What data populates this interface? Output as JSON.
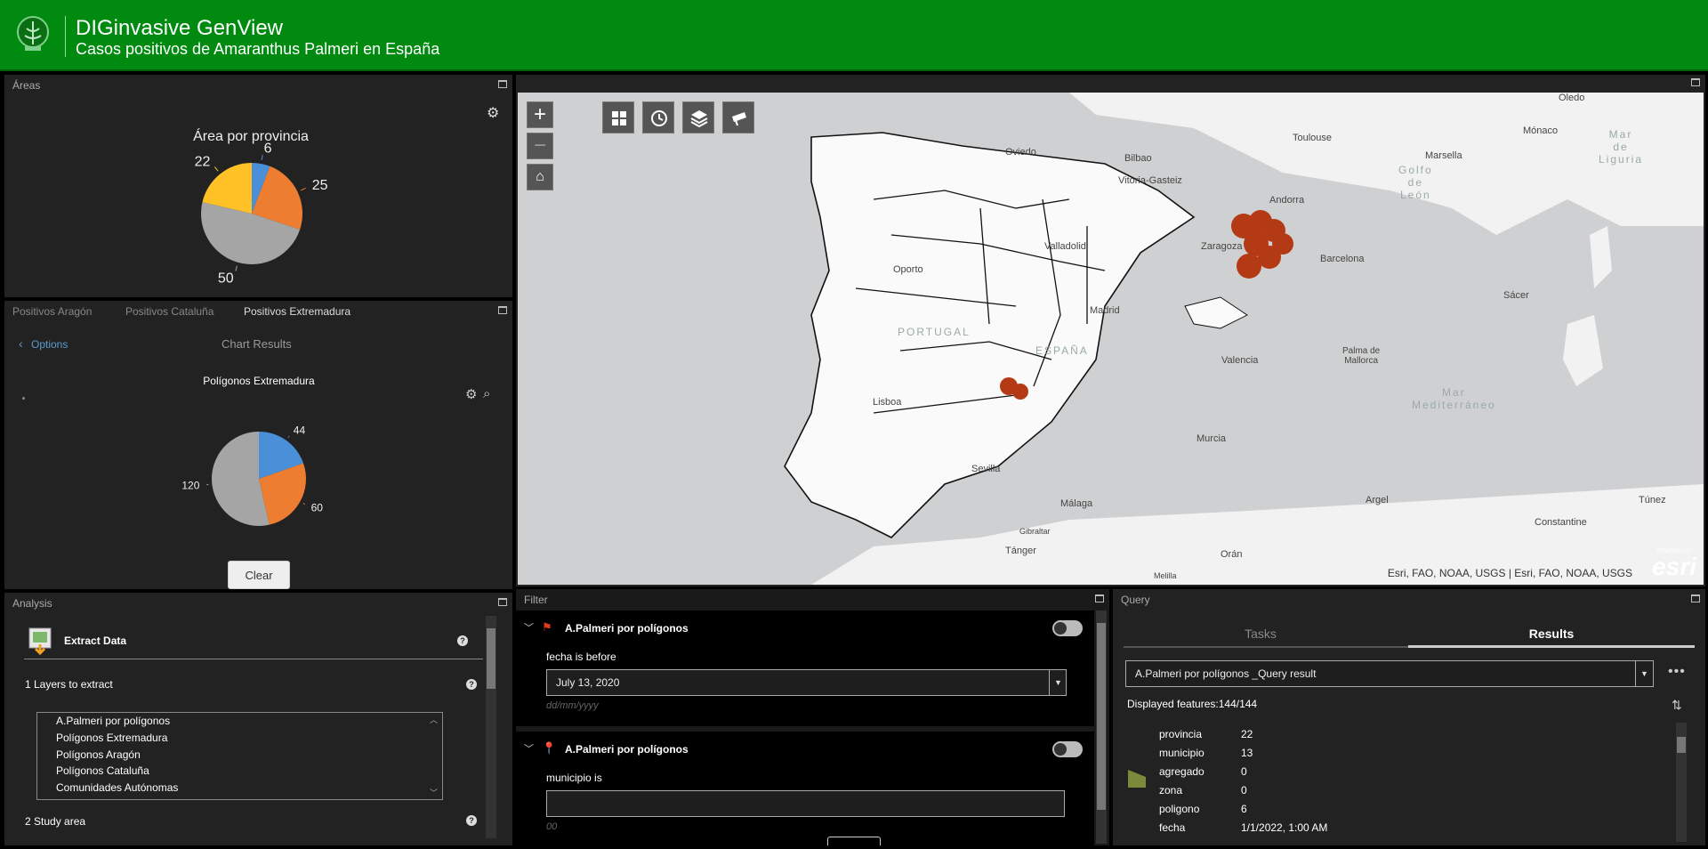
{
  "header": {
    "title": "DIGinvasive GenView",
    "subtitle": "Casos positivos de Amaranthus Palmeri en España"
  },
  "areas_panel": {
    "title": "Áreas",
    "chart_data": {
      "type": "pie",
      "title": "Área por provincia",
      "categories": [
        "6",
        "25",
        "50",
        "22"
      ],
      "values": [
        6,
        25,
        50,
        22
      ],
      "colors": [
        "#4a90d9",
        "#ed7d31",
        "#a5a5a5",
        "#ffc125"
      ]
    }
  },
  "positivos_panel": {
    "tabs": [
      "Positivos Aragón",
      "Positivos Cataluña",
      "Positivos Extremadura"
    ],
    "options_label": "Options",
    "chart_results_label": "Chart Results",
    "clear_label": "Clear",
    "chart_data": {
      "type": "pie",
      "title": "Polígonos Extremadura",
      "categories": [
        "44",
        "60",
        "120"
      ],
      "values": [
        44,
        60,
        120
      ],
      "colors": [
        "#4a90d9",
        "#ed7d31",
        "#a5a5a5"
      ]
    }
  },
  "analysis_panel": {
    "title": "Analysis",
    "extract_title": "Extract Data",
    "step1": "1 Layers to extract",
    "step2": "2 Study area",
    "layers": [
      "A.Palmeri por polígonos",
      "Polígonos Extremadura",
      "Polígonos Aragón",
      "Polígonos Cataluña",
      "Comunidades Autónomas"
    ]
  },
  "map": {
    "labels": {
      "oviedo": "Oviedo",
      "bilbao": "Bilbao",
      "vitoria": "Vitoria-Gasteiz",
      "toulouse": "Toulouse",
      "monaco": "Mónaco",
      "marsella": "Marsella",
      "golfo": "Golfo\nde\nLeón",
      "mar_liguria": "Mar\nde\nLiguria",
      "andorra": "Andorra",
      "zaragoza": "Zaragoza",
      "barcelona": "Barcelona",
      "valladolid": "Valladolid",
      "oporto": "Oporto",
      "madrid": "Madrid",
      "portugal": "PORTUGAL",
      "espana": "ESPAÑA",
      "valencia": "Valencia",
      "sacer": "Sácer",
      "palma": "Palma de\nMallorca",
      "mar_med": "Mar\nMediterráneo",
      "lisboa": "Lisboa",
      "murcia": "Murcia",
      "sevilla": "Sevilla",
      "malaga": "Málaga",
      "gibraltar": "Gibraltar",
      "tanger": "Tánger",
      "argel": "Argel",
      "tunez": "Túnez",
      "constantine": "Constantine",
      "oran": "Orán",
      "melilla": "Melilla",
      "oledo": "Oledo"
    },
    "attribution": "Esri, FAO, NOAA, USGS | Esri, FAO, NOAA, USGS",
    "esri": "esri",
    "esri_powered": "POWERED BY"
  },
  "filter_panel": {
    "title": "Filter",
    "items": [
      {
        "title": "A.Palmeri por polígonos",
        "condition": "fecha is before",
        "value": "July 13, 2020",
        "hint": "dd/mm/yyyy"
      },
      {
        "title": "A.Palmeri por polígonos",
        "condition": "municipio is",
        "value": "",
        "hint": "00"
      }
    ]
  },
  "query_panel": {
    "title": "Query",
    "tabs": [
      "Tasks",
      "Results"
    ],
    "result_select": "A.Palmeri por polígonos _Query result",
    "displayed": "Displayed features:144/144",
    "attributes": [
      {
        "key": "provincia",
        "value": "22"
      },
      {
        "key": "municipio",
        "value": "13"
      },
      {
        "key": "agregado",
        "value": "0"
      },
      {
        "key": "zona",
        "value": "0"
      },
      {
        "key": "poligono",
        "value": "6"
      },
      {
        "key": "fecha",
        "value": "1/1/2022, 1:00 AM"
      }
    ]
  }
}
